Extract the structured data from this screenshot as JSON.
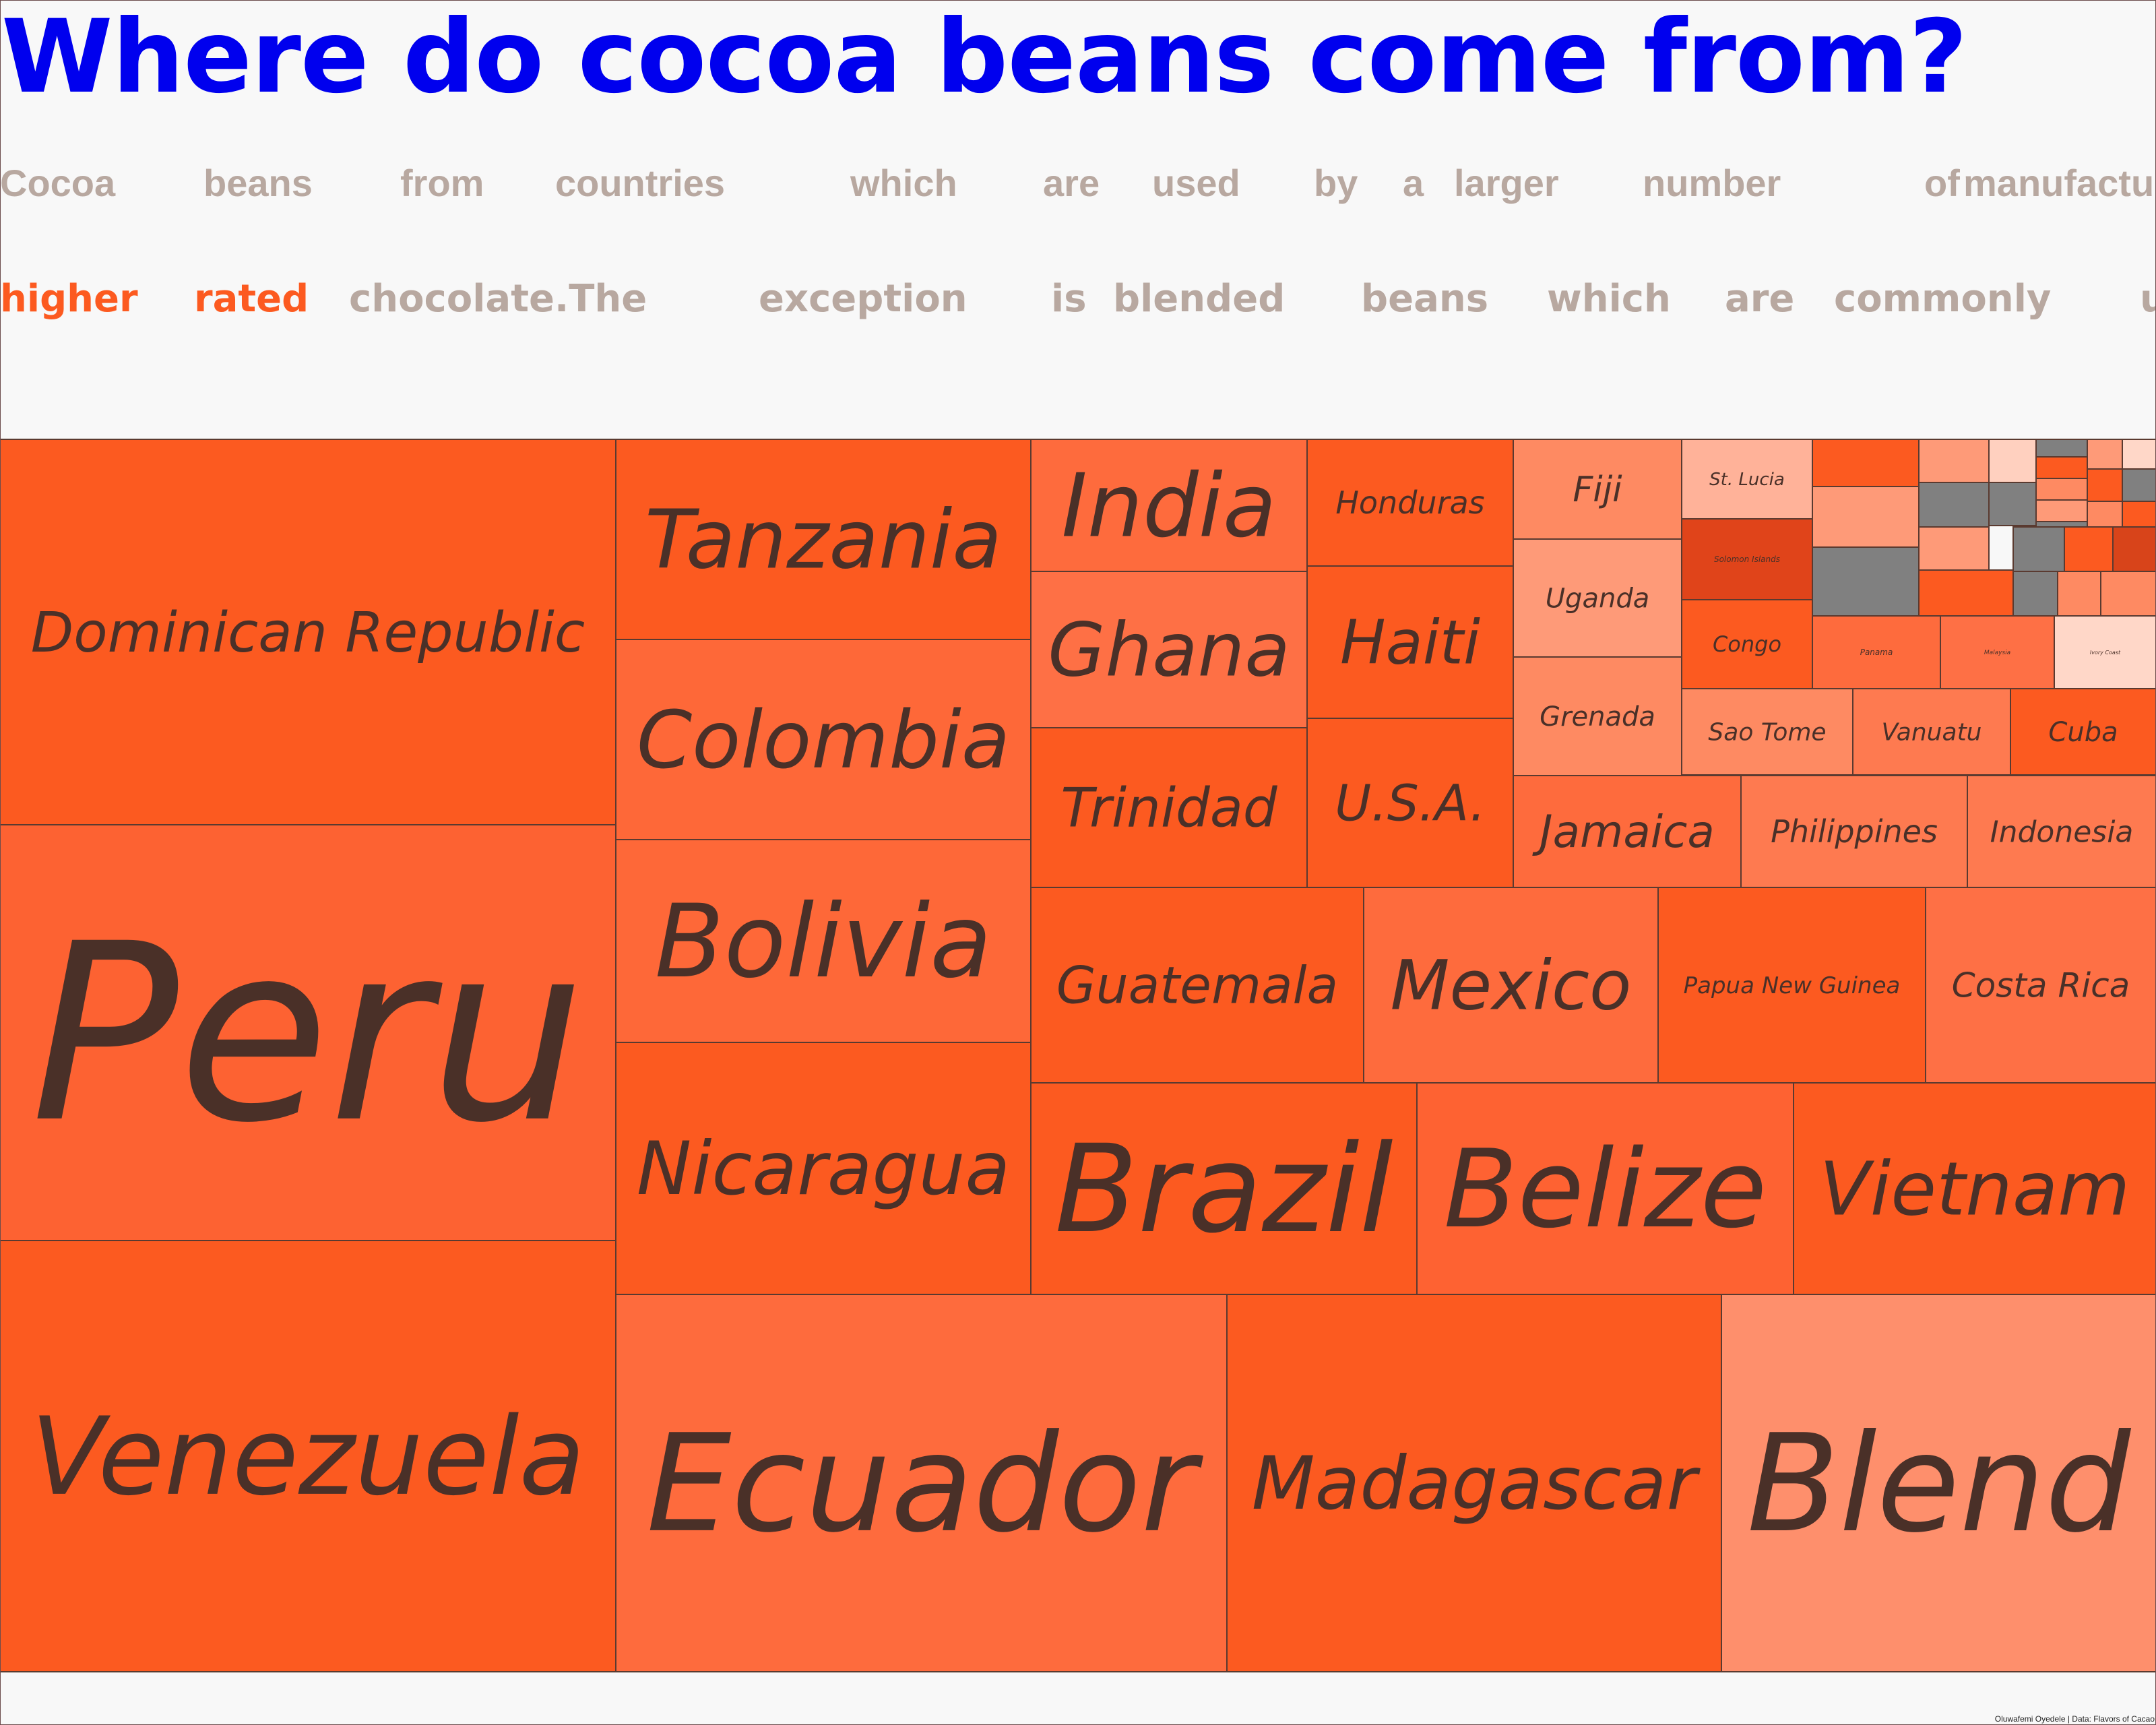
{
  "title": "Where do cocoa beans come from?",
  "subtitle_line1": [
    "Cocoa",
    "beans",
    "from",
    "countries",
    "which",
    "are",
    "used",
    "by",
    "a",
    "larger",
    "number",
    "of",
    "manufactu"
  ],
  "subtitle_line2": [
    "higher",
    "rated",
    "chocolate.The",
    "exception",
    "is",
    "blended",
    "beans",
    "which",
    "are",
    "commonly",
    "u"
  ],
  "subtitle_highlight_words": [
    "higher",
    "rated"
  ],
  "caption": "Oluwafemi Oyedele | Data: Flavors of Cacao",
  "colors": {
    "title": "#0000ee",
    "subtitle": "#b8a8a0",
    "highlight": "#fc5a20",
    "label": "#4a3028",
    "border": "#5a3a30"
  },
  "chart_data": {
    "type": "treemap",
    "title": "Where do cocoa beans come from?",
    "value_encoding": "tile area",
    "color_encoding": "rating (darker orange = higher rated, grey = no data)",
    "tiles": [
      {
        "name": "Dominican Republic",
        "color": "#fc5a20"
      },
      {
        "name": "Peru",
        "color": "#fd6232"
      },
      {
        "name": "Venezuela",
        "color": "#fc5a20"
      },
      {
        "name": "Tanzania",
        "color": "#fc5a20"
      },
      {
        "name": "Colombia",
        "color": "#fe6838"
      },
      {
        "name": "Bolivia",
        "color": "#fe6838"
      },
      {
        "name": "Nicaragua",
        "color": "#fc5a20"
      },
      {
        "name": "Ecuador",
        "color": "#fe6b3d"
      },
      {
        "name": "Madagascar",
        "color": "#fc5a20"
      },
      {
        "name": "Blend",
        "color": "#fe8f6c"
      },
      {
        "name": "India",
        "color": "#fe6b3d"
      },
      {
        "name": "Ghana",
        "color": "#fe7045"
      },
      {
        "name": "Trinidad",
        "color": "#fc5a20"
      },
      {
        "name": "Honduras",
        "color": "#fc5a20"
      },
      {
        "name": "Haiti",
        "color": "#fc5a20"
      },
      {
        "name": "U.S.A.",
        "color": "#fc5a20"
      },
      {
        "name": "Fiji",
        "color": "#fe8a62"
      },
      {
        "name": "Uganda",
        "color": "#fe9a78"
      },
      {
        "name": "Grenada",
        "color": "#fe8a62"
      },
      {
        "name": "St. Lucia",
        "color": "#ffb299"
      },
      {
        "name": "Solomon Islands",
        "color": "#e0441a"
      },
      {
        "name": "Congo",
        "color": "#fc5a20"
      },
      {
        "name": "Panama",
        "color": "#fe6b3d"
      },
      {
        "name": "Malaysia",
        "color": "#fe7045"
      },
      {
        "name": "Ivory Coast",
        "color": "#ffd7c8"
      },
      {
        "name": "Sao Tome",
        "color": "#fe8a62"
      },
      {
        "name": "Vanuatu",
        "color": "#fe7a50"
      },
      {
        "name": "Cuba",
        "color": "#fc5a20"
      },
      {
        "name": "Jamaica",
        "color": "#fe6b3d"
      },
      {
        "name": "Philippines",
        "color": "#fe7a50"
      },
      {
        "name": "Indonesia",
        "color": "#fe7a50"
      },
      {
        "name": "Guatemala",
        "color": "#fc5a20"
      },
      {
        "name": "Mexico",
        "color": "#fe6b3d"
      },
      {
        "name": "Papua New Guinea",
        "color": "#fc5a20"
      },
      {
        "name": "Costa Rica",
        "color": "#fe7045"
      },
      {
        "name": "Brazil",
        "color": "#fc5a20"
      },
      {
        "name": "Belize",
        "color": "#fe6232"
      },
      {
        "name": "Vietnam",
        "color": "#fc5a20"
      },
      {
        "name": "",
        "color": "#fc5a20"
      },
      {
        "name": "",
        "color": "#fe9a78"
      },
      {
        "name": "",
        "color": "#808080"
      },
      {
        "name": "",
        "color": "#fe9a78"
      },
      {
        "name": "",
        "color": "#808080"
      },
      {
        "name": "",
        "color": "#fe9a78"
      },
      {
        "name": "",
        "color": "#ffd0bf"
      },
      {
        "name": "",
        "color": "#808080"
      },
      {
        "name": "",
        "color": "#808080"
      },
      {
        "name": "",
        "color": "#fc5a20"
      },
      {
        "name": "",
        "color": "#fe8a62"
      },
      {
        "name": "",
        "color": "#fe9a78"
      },
      {
        "name": "",
        "color": "#808080"
      },
      {
        "name": "",
        "color": "#fe9a78"
      },
      {
        "name": "",
        "color": "#fc5a20"
      },
      {
        "name": "",
        "color": "#fe8a62"
      },
      {
        "name": "",
        "color": "#808080"
      },
      {
        "name": "",
        "color": "#fc5a20"
      },
      {
        "name": "",
        "color": "#808080"
      },
      {
        "name": "",
        "color": "#fe8a62"
      },
      {
        "name": "",
        "color": "#fc5a20"
      },
      {
        "name": "",
        "color": "#d8441a"
      },
      {
        "name": "",
        "color": "#ffd7c8"
      },
      {
        "name": "",
        "color": "#808080"
      },
      {
        "name": "",
        "color": "#fc5a20"
      },
      {
        "name": "",
        "color": "#fe8a62"
      }
    ]
  }
}
